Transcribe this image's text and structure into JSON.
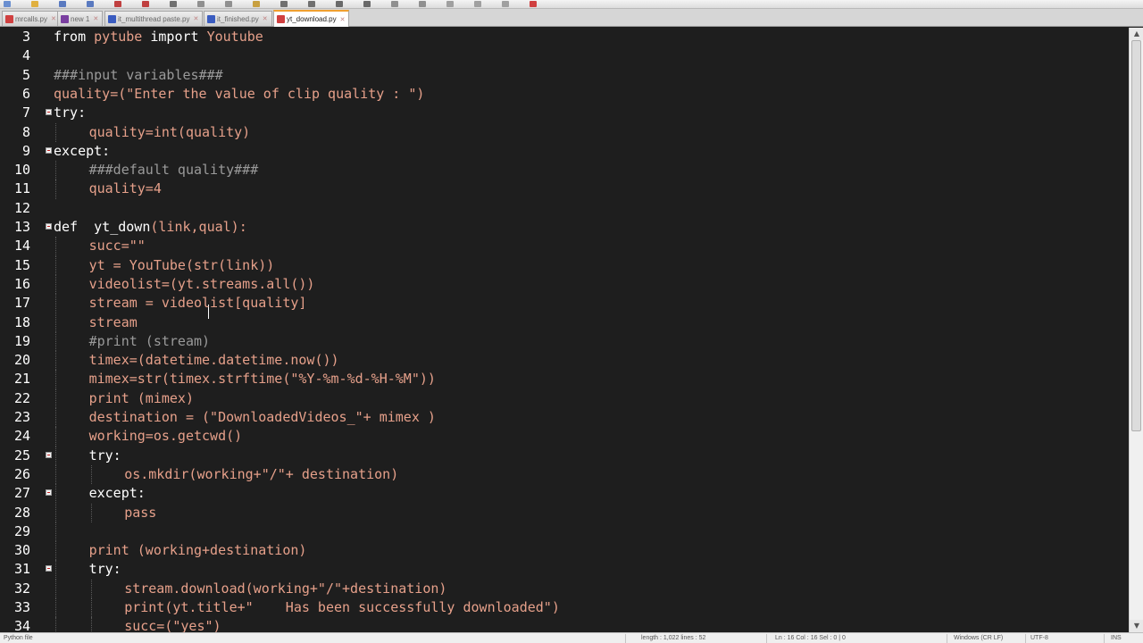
{
  "toolbar": {
    "icons": [
      "new-file-icon",
      "open-file-icon",
      "save-icon",
      "save-all-icon",
      "close-icon",
      "close-all-icon",
      "print-icon",
      "cut-icon",
      "copy-icon",
      "paste-icon",
      "undo-icon",
      "redo-icon",
      "find-icon",
      "replace-icon",
      "zoom-in-icon",
      "zoom-out-icon",
      "sync-icon",
      "wrap-icon",
      "indent-guide-icon",
      "record-macro-icon"
    ]
  },
  "tabs": [
    {
      "label": "mrcalls.py",
      "active": false,
      "icon_color": "#d04040"
    },
    {
      "label": "new 1",
      "active": false,
      "icon_color": "#7a3fa0"
    },
    {
      "label": "it_multithread paste.py",
      "active": false,
      "icon_color": "#3a5cc0"
    },
    {
      "label": "it_finished.py",
      "active": false,
      "icon_color": "#3a5cc0"
    },
    {
      "label": "yt_download.py",
      "active": true,
      "icon_color": "#d04040"
    }
  ],
  "lines": [
    {
      "n": "3",
      "fold": false,
      "indent": 0,
      "text": "from pytube import Youtube"
    },
    {
      "n": "4",
      "fold": false,
      "indent": 0,
      "text": ""
    },
    {
      "n": "5",
      "fold": false,
      "indent": 0,
      "text": "###input variables###"
    },
    {
      "n": "6",
      "fold": false,
      "indent": 0,
      "text": "quality=(\"Enter the value of clip quality : \")"
    },
    {
      "n": "7",
      "fold": true,
      "indent": 0,
      "text": "try:"
    },
    {
      "n": "8",
      "fold": false,
      "indent": 1,
      "text": "quality=int(quality)"
    },
    {
      "n": "9",
      "fold": true,
      "indent": 0,
      "text": "except:"
    },
    {
      "n": "10",
      "fold": false,
      "indent": 1,
      "text": "###default quality###"
    },
    {
      "n": "11",
      "fold": false,
      "indent": 1,
      "text": "quality=4"
    },
    {
      "n": "12",
      "fold": false,
      "indent": 0,
      "text": ""
    },
    {
      "n": "13",
      "fold": true,
      "indent": 0,
      "text": "def  yt_down(link,qual):"
    },
    {
      "n": "14",
      "fold": false,
      "indent": 1,
      "text": "succ=\"\""
    },
    {
      "n": "15",
      "fold": false,
      "indent": 1,
      "text": "yt = YouTube(str(link))"
    },
    {
      "n": "16",
      "fold": false,
      "indent": 1,
      "text": "videolist=(yt.streams.all())"
    },
    {
      "n": "17",
      "fold": false,
      "indent": 1,
      "text": "stream = videolist[quality]"
    },
    {
      "n": "18",
      "fold": false,
      "indent": 1,
      "text": "stream"
    },
    {
      "n": "19",
      "fold": false,
      "indent": 1,
      "text": "#print (stream)"
    },
    {
      "n": "20",
      "fold": false,
      "indent": 1,
      "text": "timex=(datetime.datetime.now())"
    },
    {
      "n": "21",
      "fold": false,
      "indent": 1,
      "text": "mimex=str(timex.strftime(\"%Y-%m-%d-%H-%M\"))"
    },
    {
      "n": "22",
      "fold": false,
      "indent": 1,
      "text": "print (mimex)"
    },
    {
      "n": "23",
      "fold": false,
      "indent": 1,
      "text": "destination = (\"DownloadedVideos_\"+ mimex )"
    },
    {
      "n": "24",
      "fold": false,
      "indent": 1,
      "text": "working=os.getcwd()"
    },
    {
      "n": "25",
      "fold": true,
      "indent": 1,
      "text": "try:"
    },
    {
      "n": "26",
      "fold": false,
      "indent": 2,
      "text": "os.mkdir(working+\"/\"+ destination)"
    },
    {
      "n": "27",
      "fold": true,
      "indent": 1,
      "text": "except:"
    },
    {
      "n": "28",
      "fold": false,
      "indent": 2,
      "text": "pass"
    },
    {
      "n": "29",
      "fold": false,
      "indent": 1,
      "text": ""
    },
    {
      "n": "30",
      "fold": false,
      "indent": 1,
      "text": "print (working+destination)"
    },
    {
      "n": "31",
      "fold": true,
      "indent": 1,
      "text": "try:"
    },
    {
      "n": "32",
      "fold": false,
      "indent": 2,
      "text": "stream.download(working+\"/\"+destination)"
    },
    {
      "n": "33",
      "fold": false,
      "indent": 2,
      "text": "print(yt.title+\"    Has been successfully downloaded\")"
    },
    {
      "n": "34",
      "fold": false,
      "indent": 2,
      "text": "succ=(\"yes\")"
    }
  ],
  "statusbar": {
    "file_type": "Python file",
    "length": "length : 1,022    lines : 52",
    "position": "Ln : 16    Col : 16    Sel : 0 | 0",
    "eol": "Windows (CR LF)",
    "encoding": "UTF-8",
    "mode": "INS"
  },
  "colors": {
    "background": "#1e1e1e",
    "text": "#ffffff",
    "string": "#e6a08a",
    "comment": "#9a9a9a",
    "active_tab_accent": "#f0a030"
  }
}
